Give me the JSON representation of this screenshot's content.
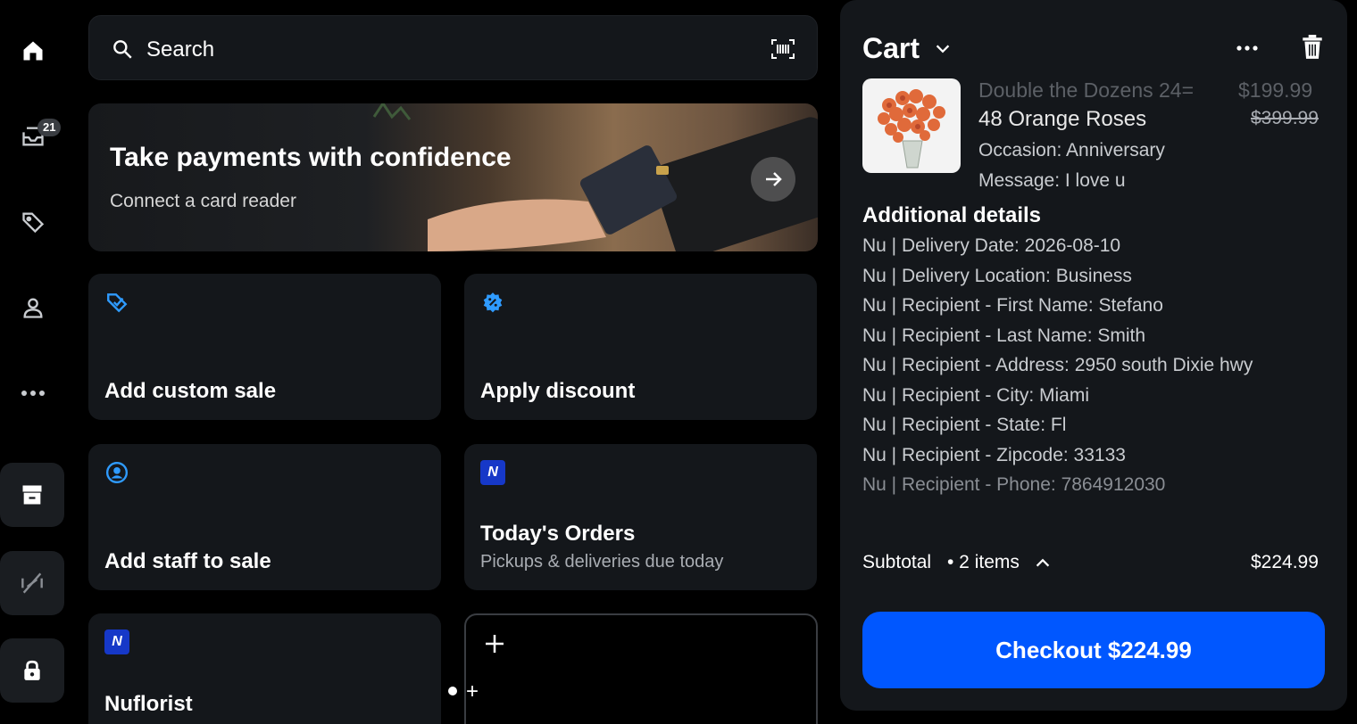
{
  "sidebar": {
    "items": [
      {
        "icon": "home-icon"
      },
      {
        "icon": "inbox-icon",
        "badge": "21"
      },
      {
        "icon": "tag-icon"
      },
      {
        "icon": "person-icon"
      },
      {
        "icon": "more-icon"
      }
    ],
    "bottom_tiles": [
      {
        "icon": "storefront-icon"
      },
      {
        "icon": "offline-icon"
      },
      {
        "icon": "lock-icon"
      }
    ]
  },
  "search": {
    "label": "Search"
  },
  "banner": {
    "title": "Take payments with confidence",
    "subtitle": "Connect a card reader"
  },
  "tiles": [
    {
      "title": "Add custom sale",
      "icon": "tag-check-icon"
    },
    {
      "title": "Apply discount",
      "icon": "discount-icon"
    },
    {
      "title": "Add staff to sale",
      "icon": "staff-icon"
    },
    {
      "title": "Today's Orders",
      "subtitle": "Pickups & deliveries due today",
      "icon": "nu-logo"
    },
    {
      "title": "Nuflorist",
      "icon": "nu-logo"
    }
  ],
  "add_tile": {
    "icon": "plus-icon"
  },
  "cart": {
    "title": "Cart",
    "item": {
      "faded_line": "Double the Dozens 24=",
      "faded_price": "$199.99",
      "name": "48 Orange Roses",
      "old_price": "$399.99",
      "occasion": "Occasion: Anniversary",
      "message": "Message: I love u"
    },
    "details_title": "Additional details",
    "details": [
      "Nu | Delivery Date: 2026-08-10",
      "Nu | Delivery Location: Business",
      "Nu | Recipient - First Name: Stefano",
      "Nu | Recipient - Last Name: Smith",
      "Nu | Recipient - Address: 2950 south Dixie hwy",
      "Nu | Recipient - City: Miami",
      "Nu | Recipient - State: Fl",
      "Nu | Recipient - Zipcode: 33133",
      "Nu | Recipient - Phone: 7864912030"
    ],
    "subtotal_label": "Subtotal",
    "subtotal_items": "• 2 items",
    "subtotal_amount": "$224.99",
    "checkout_label": "Checkout $224.99"
  },
  "colors": {
    "accent": "#0057ff",
    "panel": "#14171b",
    "nu_brand": "#1638c8",
    "icon_blue": "#2f9bff"
  }
}
